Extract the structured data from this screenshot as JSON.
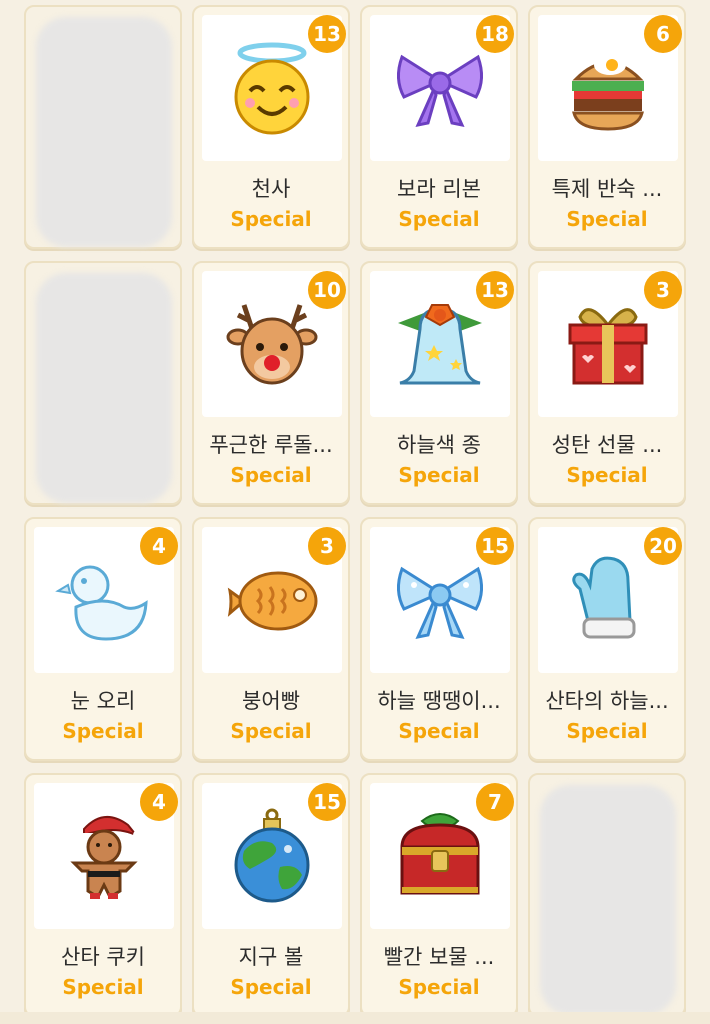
{
  "items": [
    {
      "name": "",
      "tag": "",
      "count": "",
      "icon": "hidden-item",
      "hidden": true
    },
    {
      "name": "천사",
      "tag": "Special",
      "count": "13",
      "icon": "angel-icon"
    },
    {
      "name": "보라 리본",
      "tag": "Special",
      "count": "18",
      "icon": "purple-ribbon-icon"
    },
    {
      "name": "특제 반숙 ...",
      "tag": "Special",
      "count": "6",
      "icon": "burger-icon"
    },
    {
      "name": "",
      "tag": "",
      "count": "",
      "icon": "hidden-item",
      "hidden": true
    },
    {
      "name": "푸근한 루돌...",
      "tag": "Special",
      "count": "10",
      "icon": "reindeer-icon"
    },
    {
      "name": "하늘색 종",
      "tag": "Special",
      "count": "13",
      "icon": "bell-icon"
    },
    {
      "name": "성탄 선물 ...",
      "tag": "Special",
      "count": "3",
      "icon": "gift-icon"
    },
    {
      "name": "눈 오리",
      "tag": "Special",
      "count": "4",
      "icon": "snow-duck-icon"
    },
    {
      "name": "붕어빵",
      "tag": "Special",
      "count": "3",
      "icon": "fish-bread-icon"
    },
    {
      "name": "하늘 땡땡이...",
      "tag": "Special",
      "count": "15",
      "icon": "blue-ribbon-icon"
    },
    {
      "name": "산타의 하늘...",
      "tag": "Special",
      "count": "20",
      "icon": "mitten-icon"
    },
    {
      "name": "산타 쿠키",
      "tag": "Special",
      "count": "4",
      "icon": "gingerbread-icon"
    },
    {
      "name": "지구 볼",
      "tag": "Special",
      "count": "15",
      "icon": "earth-ornament-icon"
    },
    {
      "name": "빨간 보물 ...",
      "tag": "Special",
      "count": "7",
      "icon": "treasure-chest-icon"
    },
    {
      "name": "",
      "tag": "",
      "count": "",
      "icon": "hidden-item",
      "hidden": true
    }
  ],
  "colors": {
    "badge": "#f5a50a",
    "tag": "#f5a50a",
    "card_bg": "#fbf5e6",
    "page_bg": "#f6f0e3"
  }
}
